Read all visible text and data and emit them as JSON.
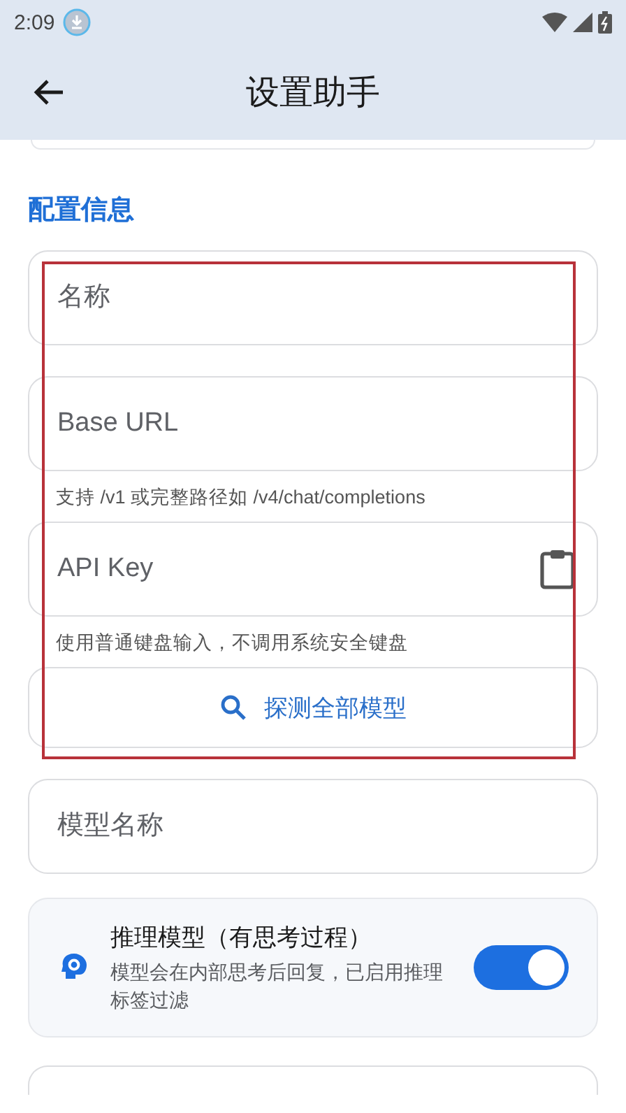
{
  "status_bar": {
    "time": "2:09"
  },
  "app_bar": {
    "title": "设置助手"
  },
  "section": {
    "title": "配置信息"
  },
  "fields": [
    {
      "kind": "text",
      "placeholder": "名称"
    },
    {
      "kind": "text",
      "placeholder": "Base URL",
      "helper": "支持 /v1 或完整路径如 /v4/chat/completions"
    },
    {
      "kind": "paste",
      "placeholder": "API Key",
      "helper": "使用普通键盘输入，不调用系统安全键盘"
    }
  ],
  "probe_button": {
    "label": "探测全部模型"
  },
  "model_field": {
    "placeholder": "模型名称"
  },
  "reasoning": {
    "title": "推理模型（有思考过程）",
    "description": "模型会在内部思考后回复，已启用推理标签过滤",
    "on": true
  }
}
